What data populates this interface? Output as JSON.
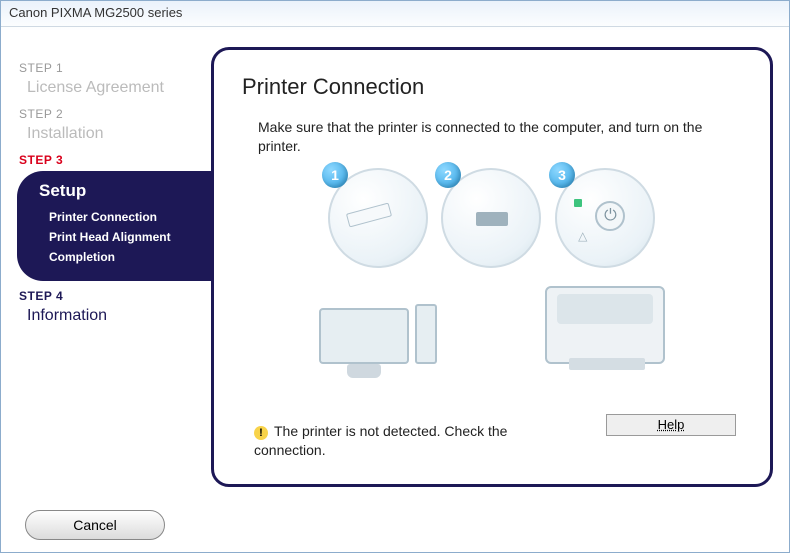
{
  "window": {
    "title": "Canon PIXMA MG2500 series"
  },
  "steps": {
    "s1": {
      "label": "STEP 1",
      "name": "License Agreement"
    },
    "s2": {
      "label": "STEP 2",
      "name": "Installation"
    },
    "s3": {
      "label": "STEP 3",
      "name": "Setup",
      "items": [
        "Printer Connection",
        "Print Head Alignment",
        "Completion"
      ]
    },
    "s4": {
      "label": "STEP 4",
      "name": "Information"
    }
  },
  "main": {
    "heading": "Printer Connection",
    "instruction": "Make sure that the printer is connected to the computer, and turn on the printer.",
    "badges": {
      "b1": "1",
      "b2": "2",
      "b3": "3"
    },
    "status": "The printer is not detected. Check the connection.",
    "help": "Help"
  },
  "footer": {
    "cancel": "Cancel"
  },
  "icons": {
    "warning": "!",
    "power": "⏻",
    "alert_triangle": "△"
  }
}
